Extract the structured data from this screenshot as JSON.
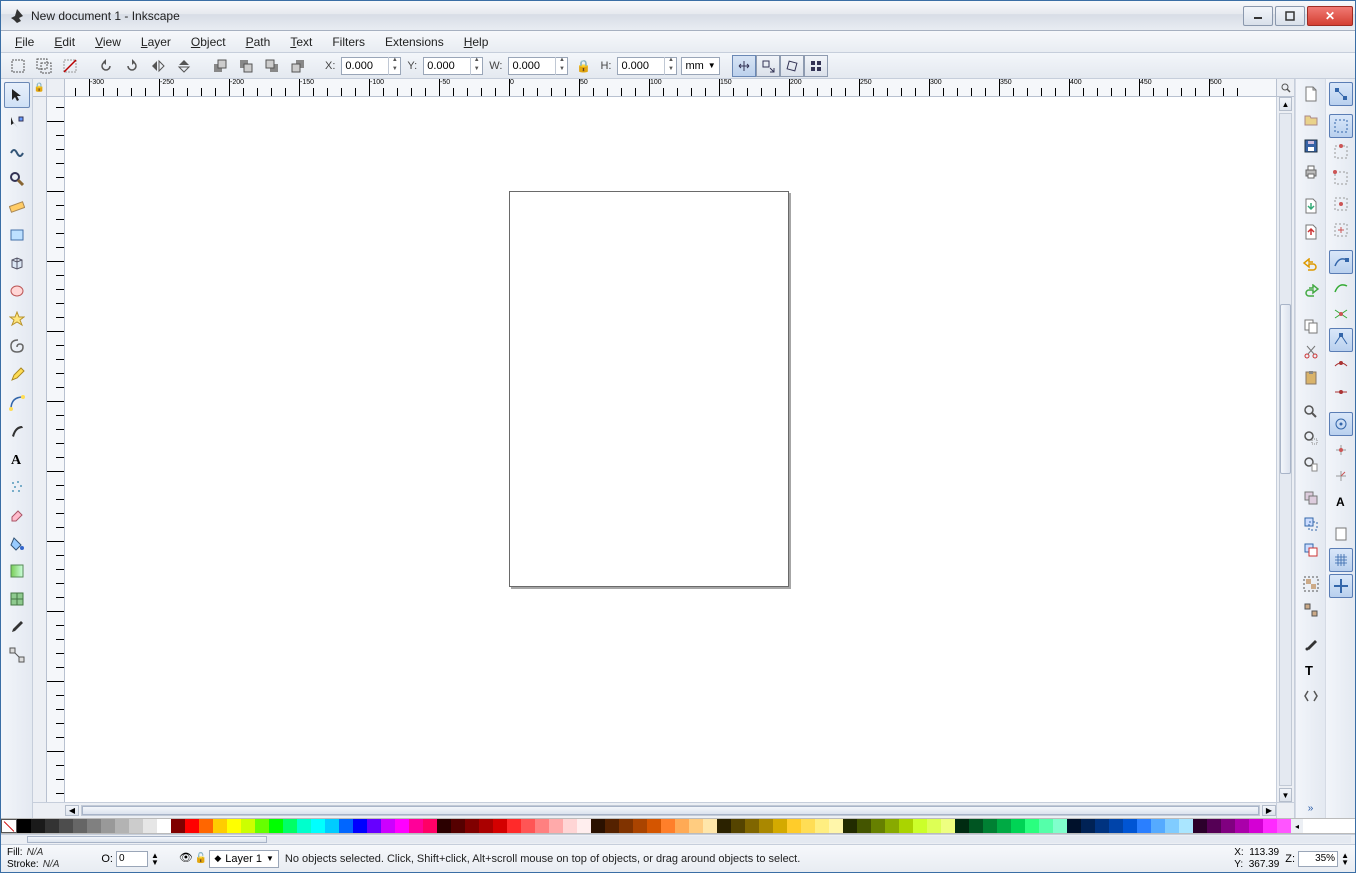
{
  "window": {
    "title": "New document 1 - Inkscape"
  },
  "menu": {
    "file": "File",
    "edit": "Edit",
    "view": "View",
    "layer": "Layer",
    "object": "Object",
    "path": "Path",
    "text": "Text",
    "filters": "Filters",
    "extensions": "Extensions",
    "help": "Help"
  },
  "toolbar": {
    "x_label": "X:",
    "y_label": "Y:",
    "w_label": "W:",
    "h_label": "H:",
    "x_value": "0.000",
    "y_value": "0.000",
    "w_value": "0.000",
    "h_value": "0.000",
    "unit": "mm"
  },
  "status": {
    "fill_label": "Fill:",
    "stroke_label": "Stroke:",
    "fill_value": "N/A",
    "stroke_value": "N/A",
    "opacity_label": "O:",
    "opacity_value": "0",
    "layer_label": "Layer 1",
    "hint": "No objects selected. Click, Shift+click, Alt+scroll mouse on top of objects, or drag around objects to select.",
    "coord_x_label": "X:",
    "coord_y_label": "Y:",
    "coord_x": "113.39",
    "coord_y": "367.39",
    "zoom_label": "Z:",
    "zoom_value": "35%"
  },
  "ruler": {
    "h_labels": [
      "-300",
      "-250",
      "-200",
      "-150",
      "-100",
      "-50",
      "0",
      "50",
      "100",
      "150",
      "200",
      "250",
      "300",
      "350",
      "400",
      "450",
      "500"
    ],
    "v_labels": [
      "0",
      "50",
      "100",
      "150",
      "200",
      "250",
      "300",
      "350",
      "400",
      "450",
      "500"
    ]
  },
  "palette": [
    "#000000",
    "#1a1a1a",
    "#333333",
    "#4d4d4d",
    "#666666",
    "#808080",
    "#999999",
    "#b3b3b3",
    "#cccccc",
    "#e6e6e6",
    "#ffffff",
    "#800000",
    "#ff0000",
    "#ff6600",
    "#ffcc00",
    "#ffff00",
    "#ccff00",
    "#66ff00",
    "#00ff00",
    "#00ff66",
    "#00ffcc",
    "#00ffff",
    "#00ccff",
    "#0066ff",
    "#0000ff",
    "#6600ff",
    "#cc00ff",
    "#ff00ff",
    "#ff0099",
    "#ff0066",
    "#2b0000",
    "#550000",
    "#800000",
    "#aa0000",
    "#d40000",
    "#ff2a2a",
    "#ff5555",
    "#ff8080",
    "#ffaaaa",
    "#ffd5d5",
    "#ffeeee",
    "#2b1100",
    "#552200",
    "#803300",
    "#aa4400",
    "#d45500",
    "#ff7f2a",
    "#ffaa55",
    "#ffcc80",
    "#ffe6aa",
    "#2b2200",
    "#554400",
    "#806600",
    "#aa8800",
    "#d4aa00",
    "#ffcc2a",
    "#ffdd55",
    "#ffee80",
    "#fff6aa",
    "#222b00",
    "#445500",
    "#668000",
    "#88aa00",
    "#aad400",
    "#ccff2a",
    "#ddff55",
    "#eeff80",
    "#002b11",
    "#005522",
    "#008033",
    "#00aa44",
    "#00d455",
    "#2aff7f",
    "#55ffaa",
    "#80ffcc",
    "#00112b",
    "#002255",
    "#003380",
    "#0044aa",
    "#0055d4",
    "#2a7fff",
    "#55aaff",
    "#80ccff",
    "#aae6ff",
    "#2b002b",
    "#550055",
    "#800080",
    "#aa00aa",
    "#d400d4",
    "#ff2aff",
    "#ff55ff"
  ]
}
